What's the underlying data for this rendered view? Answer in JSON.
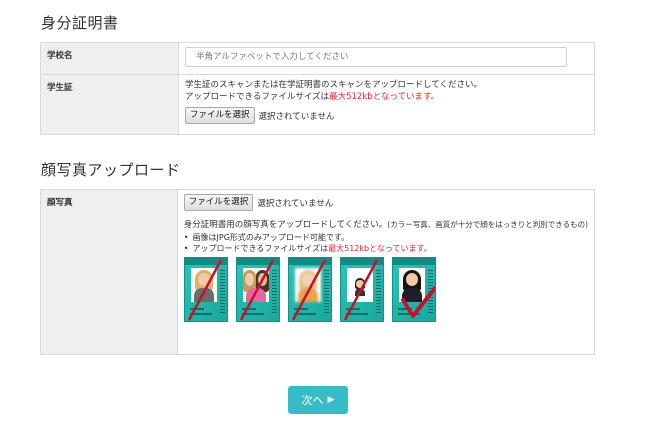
{
  "sections": {
    "id_title": "身分証明書",
    "photo_title": "顔写真アップロード"
  },
  "school": {
    "label": "学校名",
    "placeholder": "半角アルファベットで入力してください"
  },
  "student_id": {
    "label": "学生証",
    "line1": "学生証のスキャンまたは在学証明書のスキャンをアップロードしてください。",
    "line2_prefix": "アップロードできるファイルサイズは",
    "line2_red": "最大512kbとなっています。",
    "file_button": "ファイルを選択",
    "file_status": "選択されていません"
  },
  "face_photo": {
    "label": "顔写真",
    "file_button": "ファイルを選択",
    "file_status": "選択されていません",
    "desc_main": "身分証明書用の顔写真をアップロードしてください。",
    "desc_note": "(カラー写真、画質が十分で顔をはっきりと判別できるもの)",
    "rule1": "画像はJPG形式のみアップロード可能です。",
    "rule2_prefix": "アップロードできるファイルサイズは",
    "rule2_red": "最大512kbとなっています。"
  },
  "examples": [
    {
      "name": "example-bad-1",
      "valid": false
    },
    {
      "name": "example-bad-2",
      "valid": false
    },
    {
      "name": "example-bad-3",
      "valid": false
    },
    {
      "name": "example-bad-4",
      "valid": false
    },
    {
      "name": "example-good",
      "valid": true
    }
  ],
  "next_button": {
    "label": "次へ",
    "icon": "play-arrow-icon"
  },
  "colors": {
    "accent": "#35bcc6",
    "warning_red": "#e4262b",
    "card_teal": "#2fc3b6",
    "mark_red": "#c8102e"
  }
}
